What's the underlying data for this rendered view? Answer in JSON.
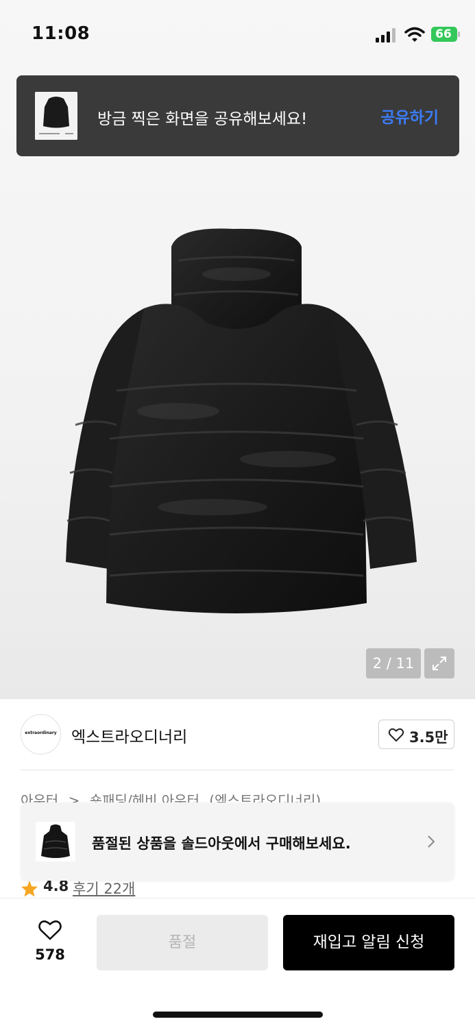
{
  "status_bar": {
    "time": "11:08",
    "battery_level": "66",
    "icons": [
      "signal-icon",
      "wifi-icon",
      "battery-icon"
    ]
  },
  "share_banner": {
    "message": "방금 찍은 화면을 공유해보세요!",
    "action_label": "공유하기",
    "action_color": "#3b7cf6"
  },
  "gallery": {
    "counter": "2 / 11",
    "expand_icon": "expand-icon"
  },
  "brand": {
    "logo_text": "extraordinary",
    "name": "엑스트라오디너리",
    "like_count": "3.5만"
  },
  "breadcrumb": {
    "items": [
      "아우터",
      ">",
      "숏패딩/헤비 아우터",
      "(엑스트라오디너리)"
    ]
  },
  "soldout_toast": {
    "message": "품절된 상품을 솔드아웃에서 구매해보세요."
  },
  "rating": {
    "score": "4.8",
    "review_label": "후기 22개",
    "star_color": "#f5a623"
  },
  "bottom_bar": {
    "wish_count": "578",
    "soldout_label": "품절",
    "restock_label": "재입고 알림 신청"
  }
}
